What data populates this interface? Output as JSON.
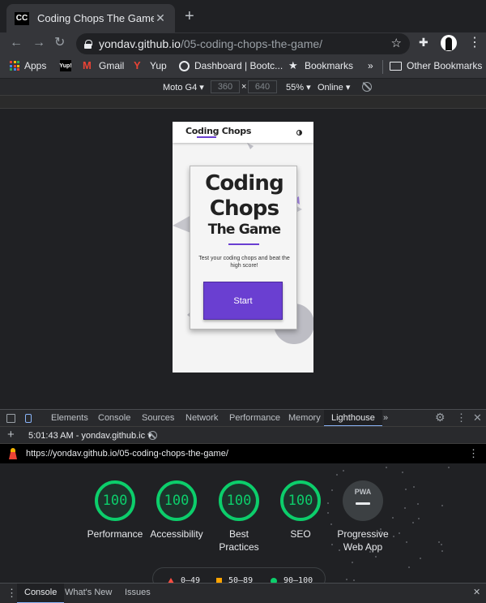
{
  "browser": {
    "tab": {
      "favicon_text": "CC",
      "title": "Coding Chops The Game",
      "close": "✕",
      "new_tab": "+"
    },
    "address": {
      "host": "yondav.github.io",
      "path": "/05-coding-chops-the-game/"
    },
    "bookmarks": [
      {
        "label": "Apps",
        "icon": "apps-grid-icon"
      },
      {
        "label": "Yup!",
        "icon": "yup-icon"
      },
      {
        "label": "Gmail",
        "icon": "gmail-icon"
      },
      {
        "label": "Yup",
        "icon": "yup-icon"
      },
      {
        "label": "Dashboard | Bootc...",
        "icon": "globe-icon"
      },
      {
        "label": "Bookmarks",
        "icon": "star-icon"
      },
      {
        "label": "»",
        "icon": "chevron-icon"
      },
      {
        "label": "Other Bookmarks",
        "icon": "folder-icon"
      }
    ]
  },
  "device_toolbar": {
    "device": "Moto G4",
    "width": "360",
    "times": "×",
    "height": "640",
    "zoom": "55%",
    "throttle": "Online"
  },
  "app": {
    "logo": "Coding Chops",
    "title_line1": "Coding",
    "title_line2": "Chops",
    "title_line3": "The Game",
    "tagline": "Test your coding chops and beat the high score!",
    "start_button": "Start",
    "accent_color": "#6a3fd1"
  },
  "devtools": {
    "tabs": [
      "Elements",
      "Console",
      "Sources",
      "Network",
      "Performance",
      "Memory",
      "Lighthouse"
    ],
    "active_tab": "Lighthouse",
    "more": "»",
    "report_time": "5:01:43 AM - yondav.github.ic",
    "add": "+",
    "report_url": "https://yondav.github.io/05-coding-chops-the-game/"
  },
  "lighthouse": {
    "scores": [
      {
        "label": "Performance",
        "value": "100"
      },
      {
        "label": "Accessibility",
        "value": "100"
      },
      {
        "label": "Best Practices",
        "value": "100"
      },
      {
        "label": "SEO",
        "value": "100"
      }
    ],
    "pwa": {
      "badge": "PWA",
      "label": "Progressive Web App"
    },
    "legend": [
      {
        "range": "0–49",
        "color": "#ff4e42"
      },
      {
        "range": "50–89",
        "color": "#ffa400"
      },
      {
        "range": "90–100",
        "color": "#0cce6b"
      }
    ],
    "pass_color": "#0cce6b"
  },
  "drawer": {
    "tabs": [
      "Console",
      "What's New",
      "Issues"
    ],
    "active_tab": "Console",
    "close": "✕"
  }
}
